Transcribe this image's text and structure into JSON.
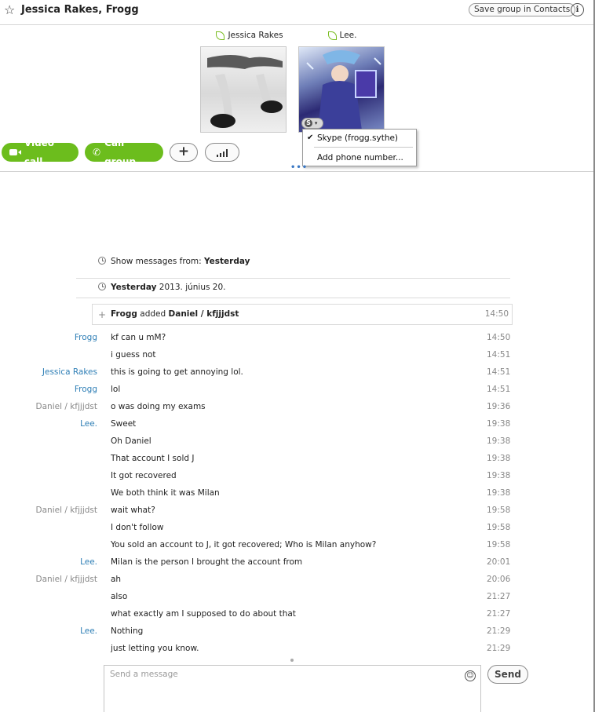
{
  "header": {
    "title": "Jessica Rakes, Frogg",
    "save_group_label": "Save group in Contacts",
    "info_label": "i"
  },
  "participants": [
    {
      "name": "Jessica Rakes"
    },
    {
      "name": "Lee."
    }
  ],
  "contact_menu": {
    "items": [
      {
        "label": "Skype (frogg.sythe)",
        "checked": true
      },
      {
        "label": "Add phone number..."
      }
    ]
  },
  "actions": {
    "video_call": "Video call",
    "call_group": "Call group",
    "add": "+"
  },
  "history": {
    "show_from_label": "Show messages from:",
    "show_from_value": "Yesterday",
    "date_bold": "Yesterday",
    "date_rest": "2013. június 20."
  },
  "event": {
    "actor": "Frogg",
    "verb": "added",
    "target": "Daniel / kfjjjdst",
    "time": "14:50"
  },
  "messages": [
    {
      "sender": "Frogg",
      "text": "kf can u mM?",
      "time": "14:50"
    },
    {
      "sender": "",
      "text": "i guess not",
      "time": "14:51"
    },
    {
      "sender": "Jessica Rakes",
      "text": "this is going to get annoying lol.",
      "time": "14:51"
    },
    {
      "sender": "Frogg",
      "text": "lol",
      "time": "14:51"
    },
    {
      "sender": "Daniel / kfjjjdst",
      "text": "o was doing my exams",
      "time": "19:36"
    },
    {
      "sender": "Lee.",
      "text": "Sweet",
      "time": "19:38"
    },
    {
      "sender": "",
      "text": "Oh Daniel",
      "time": "19:38"
    },
    {
      "sender": "",
      "text": "That account I sold J",
      "time": "19:38"
    },
    {
      "sender": "",
      "text": "It got recovered",
      "time": "19:38"
    },
    {
      "sender": "",
      "text": "We both think it was Milan",
      "time": "19:38"
    },
    {
      "sender": "Daniel / kfjjjdst",
      "text": "wait what?",
      "time": "19:58"
    },
    {
      "sender": "",
      "text": "I don't follow",
      "time": "19:58"
    },
    {
      "sender": "",
      "text": "You sold an account to J, it got recovered; Who is Milan anyhow?",
      "time": "19:58"
    },
    {
      "sender": "Lee.",
      "text": "Milan is the person I brought the account from",
      "time": "20:01"
    },
    {
      "sender": "Daniel / kfjjjdst",
      "text": "ah",
      "time": "20:06"
    },
    {
      "sender": "",
      "text": "also",
      "time": "21:27"
    },
    {
      "sender": "",
      "text": "what exactly am I supposed to do about that",
      "time": "21:27"
    },
    {
      "sender": "Lee.",
      "text": "Nothing",
      "time": "21:29"
    },
    {
      "sender": "",
      "text": "just letting you know.",
      "time": "21:29"
    }
  ],
  "composer": {
    "placeholder": "Send a message",
    "send_label": "Send"
  },
  "colors": {
    "accent_green": "#6cbd1d",
    "sender_blue": "#2f7fb6",
    "sender_gray": "#888888"
  }
}
